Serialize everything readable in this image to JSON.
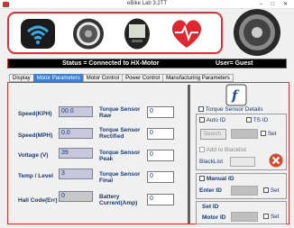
{
  "window": {
    "title": "eBike Lab 3.2TT",
    "controls": "–  □  ✕"
  },
  "iconbar": {
    "icons": [
      "wifi-icon",
      "wheel-icon",
      "display-icon",
      "heart-icon"
    ]
  },
  "status": {
    "text": "Status = Connected to HX-Motor",
    "user": "User= Guest"
  },
  "tabs": [
    "Display",
    "Motor Parameters",
    "Motor Control",
    "Power Control",
    "Manufacturing Parameters"
  ],
  "motor_params": {
    "speed_kph": {
      "label": "Speed(KPH)",
      "value": "00.0"
    },
    "speed_mph": {
      "label": "Speed(MPH)",
      "value": "0.0"
    },
    "voltage": {
      "label": "Voltage (V)",
      "value": "39"
    },
    "temp": {
      "label": "Temp / Level",
      "value": "3"
    },
    "hall": {
      "label": "Hall Code(Err)",
      "value": "0"
    },
    "ts_raw": {
      "label1": "Torque Sensor",
      "label2": "Raw",
      "value": "0"
    },
    "ts_rect": {
      "label1": "Torque Sensor",
      "label2": "Rectified",
      "value": "0"
    },
    "ts_peak": {
      "label1": "Torque Sensor",
      "label2": "Peak",
      "value": "0"
    },
    "ts_final": {
      "label1": "Torque Sensor",
      "label2": "Final",
      "value": "0"
    },
    "battery": {
      "label1": "Battery",
      "label2": "Current(Amp)",
      "value": "0"
    }
  },
  "right": {
    "ts_details": "Torque Sensor Details",
    "auto_id": "Auto ID",
    "ts_id": "TS ID",
    "search": "Search",
    "set": "Set",
    "add_blacklist": "Add to Blacklist",
    "blacklist": "BlackList",
    "manual_id": "Manual ID",
    "enter_id": "Enter ID",
    "set_id": "Set ID",
    "motor_id": "Motor ID"
  }
}
